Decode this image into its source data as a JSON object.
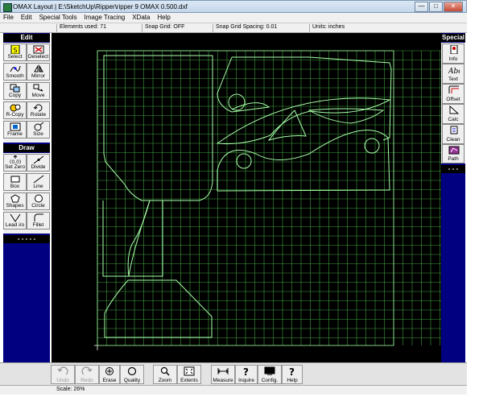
{
  "window": {
    "title": "OMAX Layout | E:\\SketchUp\\Ripper\\ripper 9 OMAX 0.500.dxf",
    "min": "—",
    "max": "□",
    "close": "✕"
  },
  "menu": [
    "File",
    "Edit",
    "Special Tools",
    "Image Tracing",
    "XData",
    "Help"
  ],
  "status": {
    "elements": "Elements used: 71",
    "snap_grid": "Snap Grid: OFF",
    "snap_spacing": "Snap Grid Spacing: 0.01",
    "units": "Units: inches"
  },
  "edit_panel": {
    "title": "Edit",
    "tools": [
      {
        "label": "Select",
        "icon": "select-icon"
      },
      {
        "label": "Deselect",
        "icon": "deselect-icon"
      },
      {
        "label": "Smooth",
        "icon": "smooth-icon"
      },
      {
        "label": "Mirror",
        "icon": "mirror-icon"
      },
      {
        "label": "Copy",
        "icon": "copy-icon"
      },
      {
        "label": "Move",
        "icon": "move-icon"
      },
      {
        "label": "R-Copy",
        "icon": "rotate-copy-icon"
      },
      {
        "label": "Rotate",
        "icon": "rotate-icon"
      },
      {
        "label": "Frame",
        "icon": "frame-icon"
      },
      {
        "label": "Size",
        "icon": "size-icon"
      }
    ]
  },
  "draw_panel": {
    "title": "Draw",
    "tools": [
      {
        "label": "Set Zero",
        "icon": "set-zero-icon"
      },
      {
        "label": "Divide",
        "icon": "divide-icon"
      },
      {
        "label": "Box",
        "icon": "box-icon"
      },
      {
        "label": "Line",
        "icon": "line-icon"
      },
      {
        "label": "Shapes",
        "icon": "shapes-icon"
      },
      {
        "label": "Circle",
        "icon": "circle-icon"
      },
      {
        "label": "Lead i/o",
        "icon": "lead-io-icon"
      },
      {
        "label": "Fillet",
        "icon": "fillet-icon"
      }
    ],
    "dashes": "- - - - -"
  },
  "special_panel": {
    "title": "Special",
    "tools": [
      {
        "label": "Info",
        "icon": "info-icon"
      },
      {
        "label": "Text",
        "icon": "text-icon"
      },
      {
        "label": "Offset",
        "icon": "offset-icon"
      },
      {
        "label": "Calc",
        "icon": "calc-icon"
      },
      {
        "label": "Clean",
        "icon": "clean-icon"
      },
      {
        "label": "Path",
        "icon": "path-icon"
      }
    ],
    "dashes": "- - -"
  },
  "bottom_tools": [
    {
      "label": "Undo",
      "icon": "undo-icon",
      "disabled": true
    },
    {
      "label": "Redo",
      "icon": "redo-icon",
      "disabled": true
    },
    {
      "label": "Erase",
      "icon": "erase-icon",
      "disabled": false
    },
    {
      "label": "Quality",
      "icon": "quality-icon",
      "disabled": false
    },
    {
      "label": "Zoom",
      "icon": "zoom-icon",
      "disabled": false
    },
    {
      "label": "Extents",
      "icon": "extents-icon",
      "disabled": false
    },
    {
      "label": "Measure",
      "icon": "measure-icon",
      "disabled": false
    },
    {
      "label": "Inquire",
      "icon": "inquire-icon",
      "disabled": false
    },
    {
      "label": "Config.",
      "icon": "config-icon",
      "disabled": false
    },
    {
      "label": "Help",
      "icon": "help-icon",
      "disabled": false
    }
  ],
  "scale": "Scale: 26%",
  "colors": {
    "panel": "#000080",
    "canvas": "#000000",
    "grid": "#3f9f3f",
    "geometry": "#9fff9f"
  }
}
